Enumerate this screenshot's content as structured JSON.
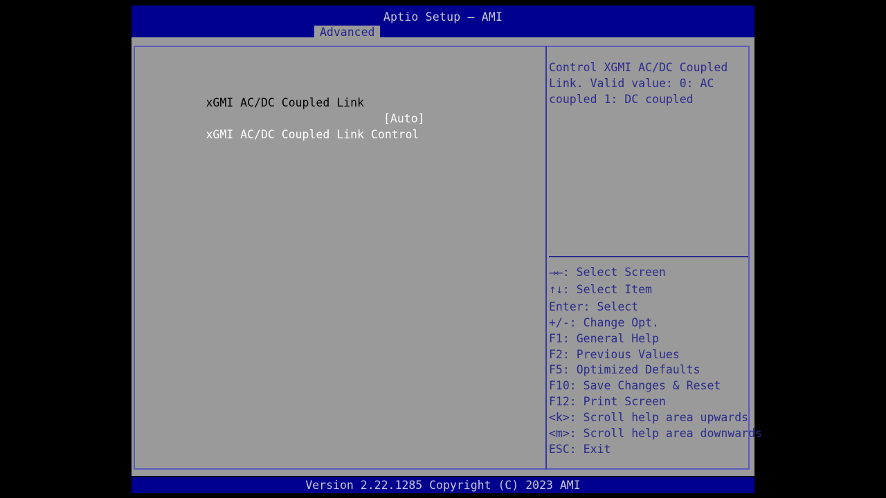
{
  "window": {
    "title": "Aptio Setup – AMI",
    "colors": {
      "header_blue": "#00008f",
      "body_gray": "#9a9a9a",
      "border_lavender": "#5b5bbe",
      "help_navy": "#2b2b8c",
      "value_white": "#ffffff",
      "heading_black": "#000000",
      "desktop_black": "#000000"
    }
  },
  "tabs": [
    {
      "label": "Advanced",
      "active": true
    }
  ],
  "main": {
    "settings": [
      {
        "type": "heading",
        "label": "xGMI AC/DC Coupled Link",
        "value": ""
      },
      {
        "type": "option",
        "label": "xGMI AC/DC Coupled Link Control",
        "value": "[Auto]"
      }
    ]
  },
  "help": {
    "description": "Control XGMI AC/DC Coupled Link. Valid value: 0: AC coupled 1: DC coupled",
    "keys": [
      {
        "glyph": "→←",
        "text": ": Select Screen"
      },
      {
        "glyph": "↑↓",
        "text": ": Select Item"
      },
      {
        "glyph": "",
        "text": "Enter: Select"
      },
      {
        "glyph": "",
        "text": "+/-: Change Opt."
      },
      {
        "glyph": "",
        "text": "F1: General Help"
      },
      {
        "glyph": "",
        "text": "F2: Previous Values"
      },
      {
        "glyph": "",
        "text": "F5: Optimized Defaults"
      },
      {
        "glyph": "",
        "text": "F10: Save Changes & Reset"
      },
      {
        "glyph": "",
        "text": "F12: Print Screen"
      },
      {
        "glyph": "",
        "text": "<k>: Scroll help area upwards"
      },
      {
        "glyph": "",
        "text": "<m>: Scroll help area downwards"
      },
      {
        "glyph": "",
        "text": "ESC: Exit"
      }
    ]
  },
  "footer": {
    "version_text": "Version 2.22.1285 Copyright (C) 2023 AMI"
  }
}
